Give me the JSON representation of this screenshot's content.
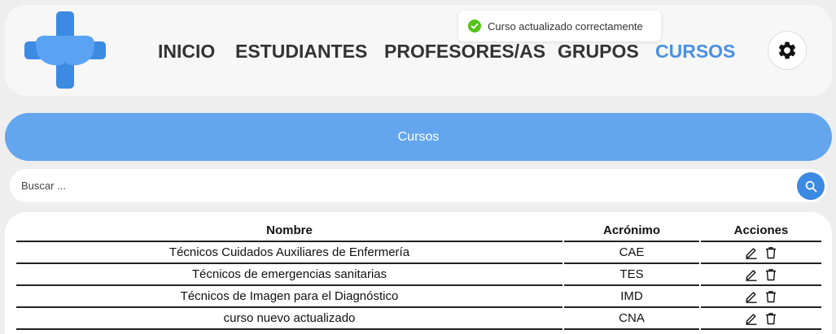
{
  "colors": {
    "accent": "#4a90e2",
    "banner": "#63a6ee",
    "success": "#52c41a",
    "logo": "#3d8ae3"
  },
  "nav": {
    "items": [
      {
        "label": "INICIO",
        "active": false
      },
      {
        "label": "ESTUDIANTES",
        "active": false
      },
      {
        "label": "PROFESORES/AS",
        "active": false
      },
      {
        "label": "GRUPOS",
        "active": false
      },
      {
        "label": "CURSOS",
        "active": true
      }
    ],
    "settings_icon": "gear-icon"
  },
  "toast": {
    "icon": "check-circle-icon",
    "message": "Curso actualizado correctamente"
  },
  "banner": {
    "title": "Cursos"
  },
  "search": {
    "placeholder": "Buscar ...",
    "value": "",
    "icon": "search-icon"
  },
  "table": {
    "headers": [
      "Nombre",
      "Acrónimo",
      "Acciones"
    ],
    "rows": [
      {
        "nombre": "Técnicos Cuidados Auxiliares de Enfermería",
        "acronimo": "CAE"
      },
      {
        "nombre": "Técnicos de emergencias sanitarias",
        "acronimo": "TES"
      },
      {
        "nombre": "Técnicos de Imagen para el Diagnóstico",
        "acronimo": "IMD"
      },
      {
        "nombre": "curso nuevo actualizado",
        "acronimo": "CNA"
      }
    ],
    "row_actions": [
      "edit-icon",
      "trash-icon"
    ]
  }
}
